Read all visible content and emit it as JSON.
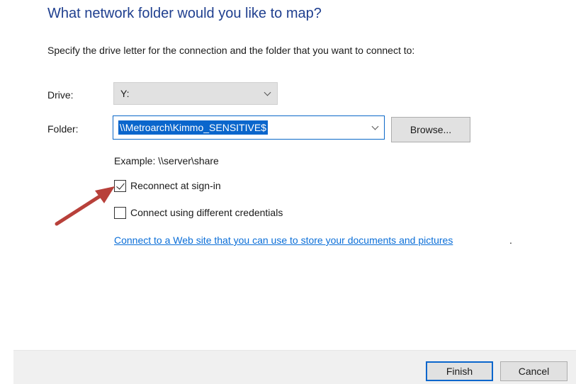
{
  "dialog": {
    "title": "What network folder would you like to map?",
    "instruction": "Specify the drive letter for the connection and the folder that you want to connect to:"
  },
  "drive": {
    "label": "Drive:",
    "value": "Y:"
  },
  "folder": {
    "label": "Folder:",
    "value": "\\\\Metroarch\\Kimmo_SENSITIVE$",
    "browse_label": "Browse..."
  },
  "example_text": "Example: \\\\server\\share",
  "options": {
    "reconnect": {
      "label": "Reconnect at sign-in",
      "checked": true
    },
    "different_credentials": {
      "label": "Connect using different credentials",
      "checked": false
    }
  },
  "web_link": {
    "text": "Connect to a Web site that you can use to store your documents and pictures",
    "trailing": "."
  },
  "footer": {
    "finish_label": "Finish",
    "cancel_label": "Cancel"
  },
  "colors": {
    "title": "#1f3f8f",
    "link": "#0a6ed8",
    "selection": "#0a66cc",
    "annotation_arrow": "#b8403a"
  }
}
